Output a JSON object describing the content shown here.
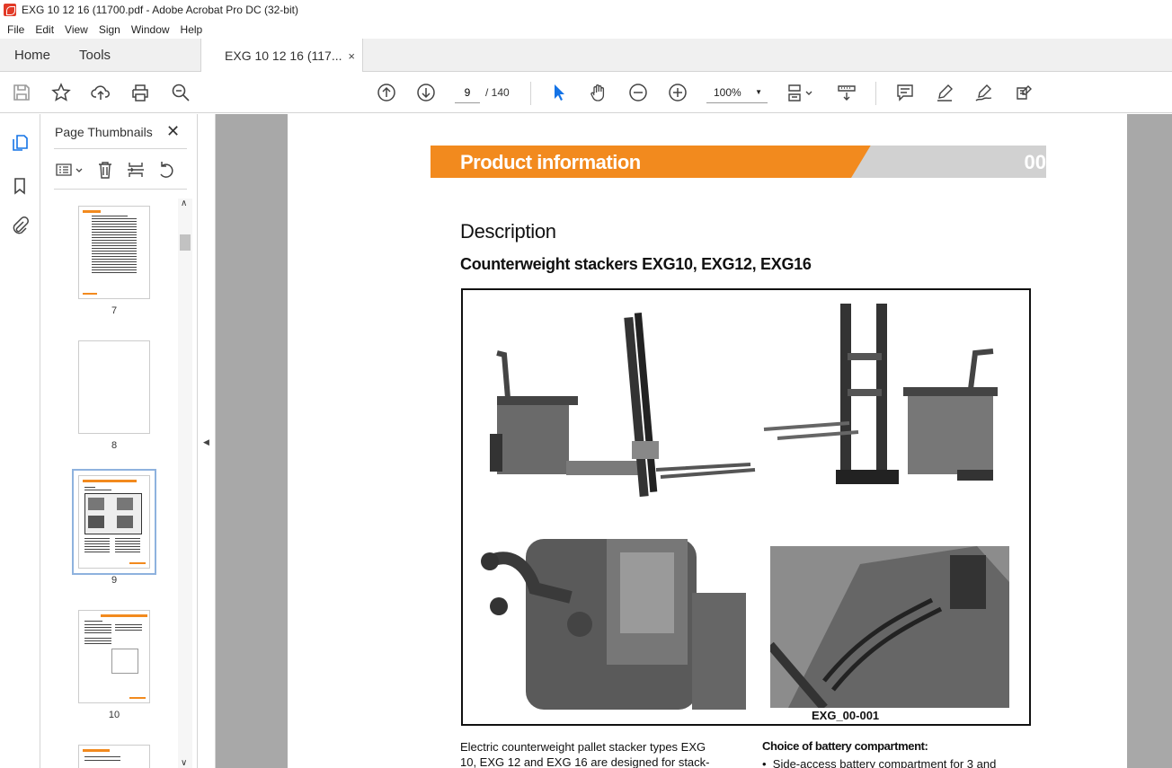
{
  "window": {
    "title": "EXG 10 12 16 (11700.pdf - Adobe Acrobat Pro DC (32-bit)"
  },
  "menu": [
    "File",
    "Edit",
    "View",
    "Sign",
    "Window",
    "Help"
  ],
  "tabs": {
    "home": "Home",
    "tools": "Tools",
    "document": "EXG 10 12 16 (117...",
    "close": "×"
  },
  "toolbar": {
    "page_current": "9",
    "page_total": "/ 140",
    "zoom": "100%"
  },
  "panel": {
    "title": "Page Thumbnails",
    "thumbnails": [
      {
        "label": "7"
      },
      {
        "label": "8"
      },
      {
        "label": "9",
        "selected": true
      },
      {
        "label": "10"
      }
    ]
  },
  "document": {
    "banner_title": "Product information",
    "banner_number": "00",
    "heading": "Description",
    "subheading": "Counterweight stackers EXG10, EXG12, EXG16",
    "figure_caption": "EXG_00-001",
    "body_left_1": "Electric counterweight pallet stacker types EXG",
    "body_left_2": "10, EXG 12 and EXG 16 are designed for stack-",
    "body_right_heading": "Choice of battery compartment:",
    "body_right_item": "Side-access battery compartment for 3 and"
  },
  "colors": {
    "accent_orange": "#f28a1e",
    "banner_grey": "#d1d1d1",
    "doc_background": "#a8a8a8",
    "selection_blue": "#8eb2de"
  }
}
